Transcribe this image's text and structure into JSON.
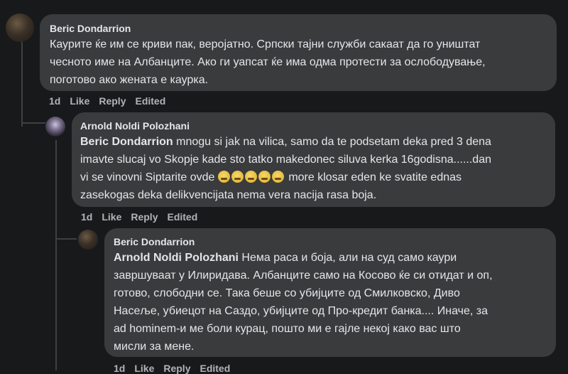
{
  "comments": [
    {
      "author": "Beric Dondarrion",
      "lines": [
        "Каурите ќе им се криви пак, веројатно. Српски тајни служби сакаат да го уништат",
        "чесното име на Албанците. Ако ги уапсат ќе има одма протести за ослободување,",
        "поготово ако жената е каурка."
      ],
      "time": "1d",
      "like": "Like",
      "reply": "Reply",
      "edited": "Edited"
    },
    {
      "author": "Arnold Noldi Polozhani",
      "mention": "Beric Dondarrion",
      "line1_rest": " mnogu si jak na vilica, samo da te podsetam deka pred 3 dena",
      "line2": "imavte slucaj vo Skopje kade sto tatko makedonec siluva kerka 16godisna......dan",
      "line3_start": "vi se vinovni Siptarite ovde ",
      "line3_end": " more klosar eden ke svatite ednas",
      "line4": "zasekogas deka delikvencijata nema vera nacija rasa boja.",
      "emojis": [
        "tired-face",
        "tired-face",
        "tired-face",
        "tired-face",
        "tired-face"
      ],
      "time": "1d",
      "like": "Like",
      "reply": "Reply",
      "edited": "Edited"
    },
    {
      "author": "Beric Dondarrion",
      "mention": "Arnold Noldi Polozhani",
      "line1_rest": " Нема раса и боја, али на суд само каури",
      "lines": [
        "завршуваат у Илиридава. Албанците само на Косово ќе си отидат и оп,",
        "готово, слободни се. Така беше со убијците од Смилковско, Диво",
        "Насеље, убиецот на Саздо, убијците од Про-кредит банка.... Иначе, за",
        "ad hominem-и ме боли курац, пошто ми е гајле некој како вас што",
        "мисли за мене."
      ],
      "time": "1d",
      "like": "Like",
      "reply": "Reply",
      "edited": "Edited"
    }
  ]
}
